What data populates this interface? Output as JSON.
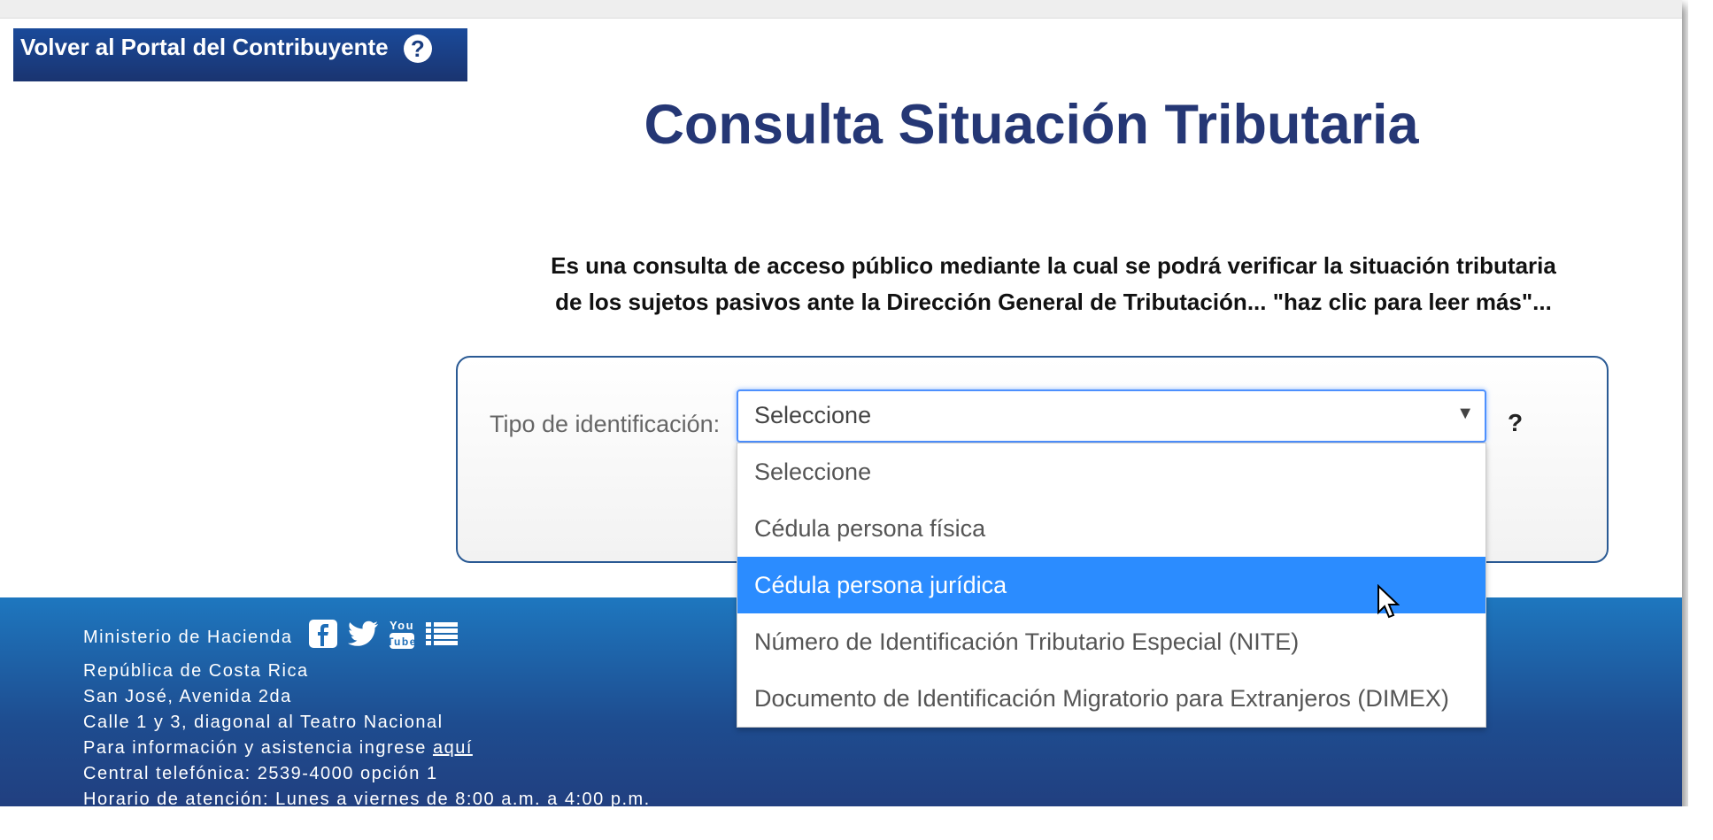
{
  "header": {
    "back_button_label": "Volver al Portal del Contribuyente",
    "help_symbol": "?"
  },
  "main": {
    "title": "Consulta Situación Tributaria",
    "intro_line1": "Es una consulta de acceso público mediante la cual se podrá verificar la situación tributaria",
    "intro_line2": "de los sujetos pasivos ante la Dirección General de Tributación... \"haz clic para leer más\"..."
  },
  "form": {
    "id_type_label": "Tipo de identificación:",
    "selected_value": "Seleccione",
    "help_symbol": "?",
    "options": [
      "Seleccione",
      "Cédula persona física",
      "Cédula persona jurídica",
      "Número de Identificación Tributario Especial (NITE)",
      "Documento de Identificación Migratorio para Extranjeros (DIMEX)"
    ],
    "highlighted_option": "Cédula persona jurídica"
  },
  "footer": {
    "ministry": "Ministerio de Hacienda",
    "country": "República de Costa Rica",
    "address1": "San José, Avenida 2da",
    "address2": "Calle 1 y 3, diagonal al Teatro Nacional",
    "info_text": "Para información y asistencia ingrese",
    "info_link": "aquí",
    "phone": "Central telefónica: 2539-4000 opción 1",
    "hours": "Horario de atención: Lunes a viernes de 8:00 a.m. a 4:00 p.m.",
    "social_icons": [
      "facebook-icon",
      "twitter-icon",
      "youtube-icon",
      "list-icon"
    ]
  },
  "colors": {
    "title": "#253775",
    "button_bg": "#1a3d80",
    "select_focus": "#4d90fe",
    "option_highlight": "#2b8cff",
    "footer_top": "#1e77bf",
    "footer_bottom": "#223c7c"
  }
}
